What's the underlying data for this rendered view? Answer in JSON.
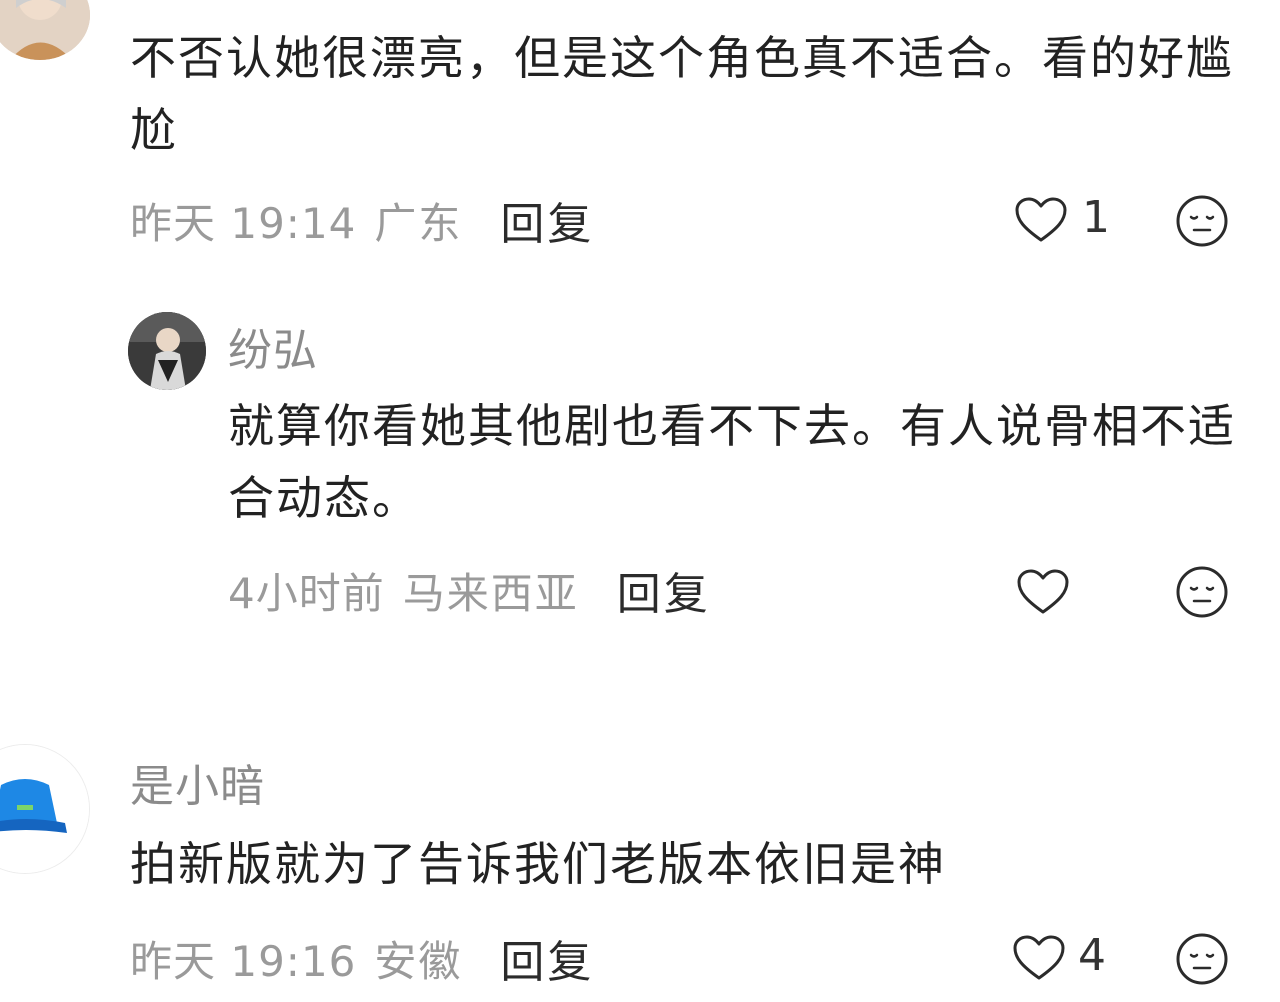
{
  "comments": [
    {
      "text": "不否认她很漂亮，但是这个角色真不适合。看的好尴尬",
      "time": "昨天 19:14",
      "location": "广东",
      "reply_label": "回复",
      "likes": "1"
    },
    {
      "username": "纷弘",
      "text": "就算你看她其他剧也看不下去。有人说骨相不适合动态。",
      "time": "4小时前",
      "location": "马来西亚",
      "reply_label": "回复",
      "likes": ""
    },
    {
      "username": "是小暗",
      "text": "拍新版就为了告诉我们老版本依旧是神",
      "time": "昨天 19:16",
      "location": "安徽",
      "reply_label": "回复",
      "likes": "4"
    }
  ],
  "icons": {
    "like": "heart-outline-icon",
    "emoji": "neutral-face-icon"
  },
  "colors": {
    "meta": "#9a9a9a",
    "username": "#8b8b8b",
    "text": "#222222",
    "avatar_bucket_hat": "#1e88e5"
  }
}
